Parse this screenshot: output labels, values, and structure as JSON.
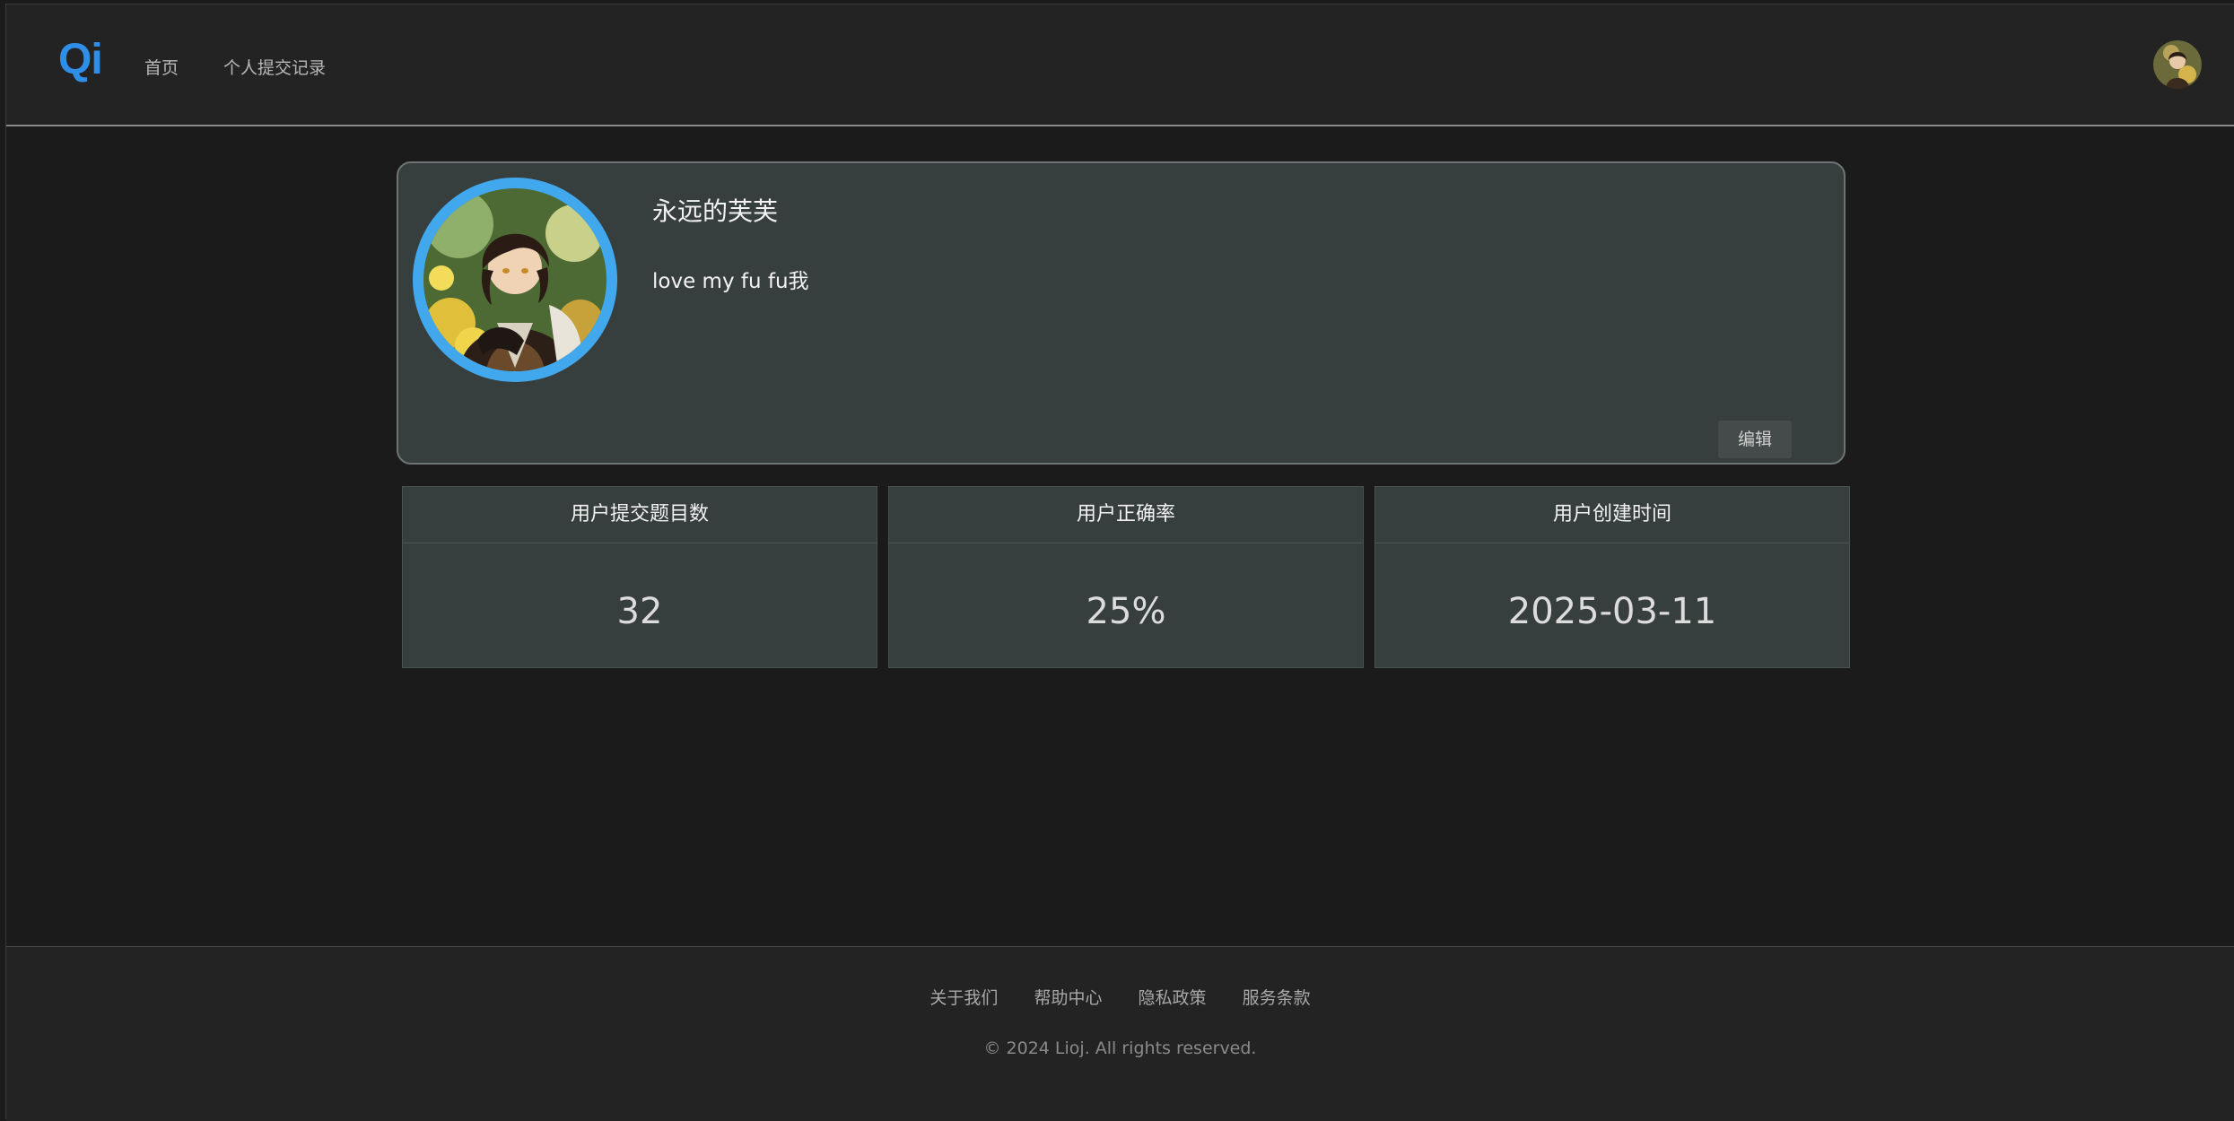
{
  "header": {
    "logo": "Qi",
    "nav": [
      {
        "label": "首页"
      },
      {
        "label": "个人提交记录"
      }
    ]
  },
  "profile": {
    "name": "永远的芙芙",
    "bio": "love my fu fu我",
    "edit_label": "编辑"
  },
  "stats": [
    {
      "label": "用户提交题目数",
      "value": "32"
    },
    {
      "label": "用户正确率",
      "value": "25%"
    },
    {
      "label": "用户创建时间",
      "value": "2025-03-11"
    }
  ],
  "footer": {
    "links": [
      {
        "label": "关于我们"
      },
      {
        "label": "帮助中心"
      },
      {
        "label": "隐私政策"
      },
      {
        "label": "服务条款"
      }
    ],
    "copyright": "© 2024 Lioj. All rights reserved."
  },
  "colors": {
    "accent": "#2f8fe8",
    "avatar_ring": "#42a8ee",
    "card_bg": "#373e3e",
    "page_bg": "#1b1b1b"
  }
}
